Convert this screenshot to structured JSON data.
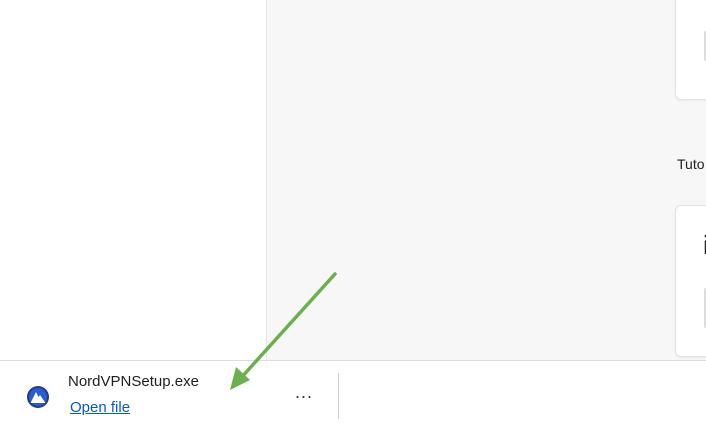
{
  "page": {
    "section_label": "Tuto",
    "card_glyph": "i"
  },
  "download": {
    "file_name": "NordVPNSetup.exe",
    "open_label": "Open file",
    "more_label": "...",
    "icon": "nordvpn-icon"
  },
  "annotation": {
    "arrow_color": "#6ab04c",
    "icon": "arrow-annotation"
  },
  "colors": {
    "link": "#0b57d0",
    "pane_background": "#f7f7f7",
    "nordvpn_blue": "#1f3c88"
  }
}
